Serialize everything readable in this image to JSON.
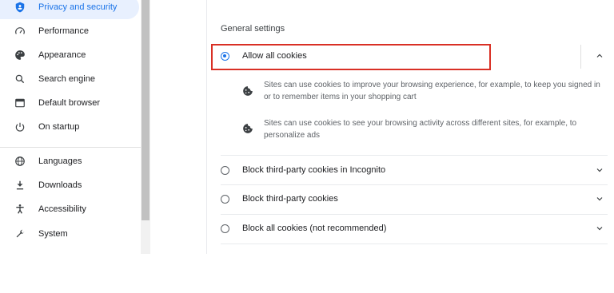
{
  "sidebar": {
    "items": [
      {
        "label": "Privacy and security",
        "icon": "shield-icon",
        "active": true
      },
      {
        "label": "Performance",
        "icon": "speedometer-icon"
      },
      {
        "label": "Appearance",
        "icon": "palette-icon"
      },
      {
        "label": "Search engine",
        "icon": "search-icon"
      },
      {
        "label": "Default browser",
        "icon": "browser-window-icon"
      },
      {
        "label": "On startup",
        "icon": "power-icon"
      },
      {
        "label": "Languages",
        "icon": "globe-icon"
      },
      {
        "label": "Downloads",
        "icon": "download-icon"
      },
      {
        "label": "Accessibility",
        "icon": "accessibility-icon"
      },
      {
        "label": "System",
        "icon": "wrench-icon"
      }
    ]
  },
  "main": {
    "section_title": "General settings",
    "options": [
      {
        "label": "Allow all cookies",
        "selected": true,
        "expanded": true
      },
      {
        "label": "Block third-party cookies in Incognito",
        "selected": false
      },
      {
        "label": "Block third-party cookies",
        "selected": false
      },
      {
        "label": "Block all cookies (not recommended)",
        "selected": false
      }
    ],
    "allow_details": [
      "Sites can use cookies to improve your browsing experience, for example, to keep you signed in or to remember items in your shopping cart",
      "Sites can use cookies to see your browsing activity across different sites, for example, to personalize ads"
    ]
  },
  "colors": {
    "accent": "#1a73e8",
    "highlight": "#d93025"
  }
}
